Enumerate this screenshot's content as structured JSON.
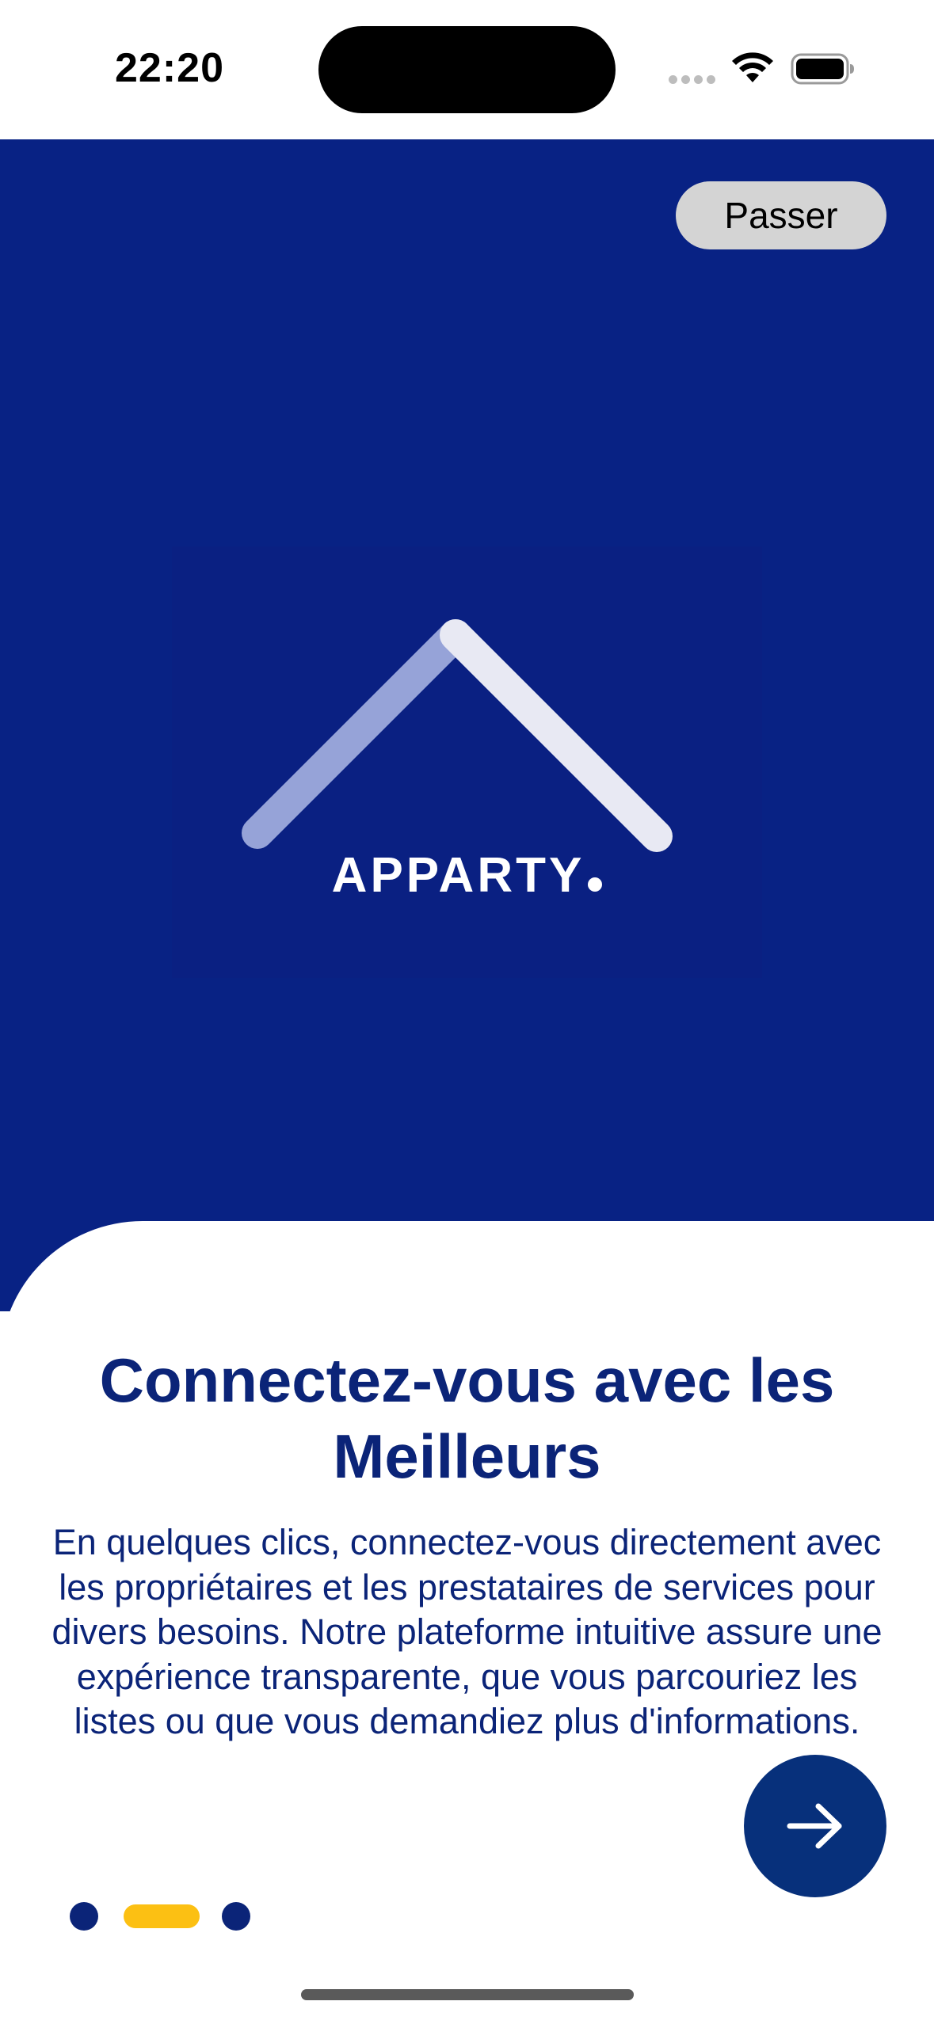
{
  "status_bar": {
    "time": "22:20"
  },
  "onboarding": {
    "skip_label": "Passer",
    "logo_text": "APPARTY",
    "title": "Connectez-vous avec les Meilleurs",
    "description": "En quelques clics, connectez-vous directement avec les propriétaires et les prestataires de services pour divers besoins. Notre plateforme intuitive assure une expérience transparente, que vous parcouriez les listes ou que vous demandiez plus d'informations.",
    "next_icon": "arrow-right-icon",
    "pages_total": 3,
    "active_page": 2
  },
  "colors": {
    "hero_background": "#082284",
    "primary_text": "#0b2478",
    "accent": "#fcc013",
    "next_button": "#07307b",
    "skip_button": "#d4d4d4"
  }
}
